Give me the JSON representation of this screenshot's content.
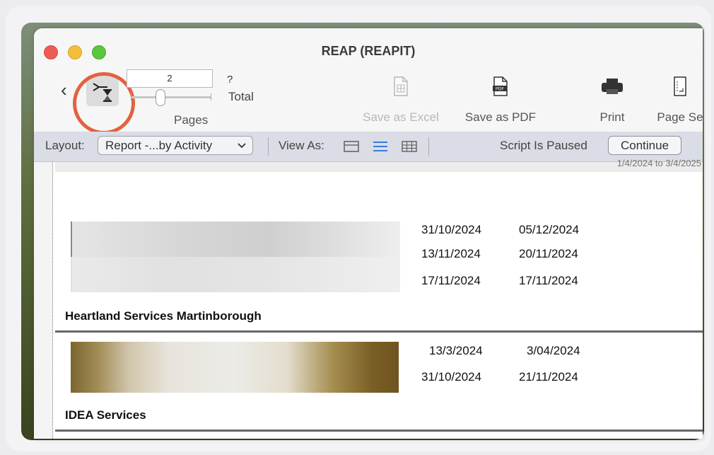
{
  "window": {
    "title": "REAP (REAPIT)"
  },
  "toolbar": {
    "back_icon": "chevron-left-icon",
    "script_icon": "script-hourglass-icon",
    "page_value": "2",
    "page_total_value": "?",
    "total_label": "Total",
    "pages_label": "Pages",
    "save_excel_label": "Save as Excel",
    "save_pdf_label": "Save as PDF",
    "print_label": "Print",
    "page_setup_label": "Page Se"
  },
  "layout_bar": {
    "layout_label": "Layout:",
    "layout_value": "Report -...by Activity",
    "view_as_label": "View As:",
    "status_text": "Script Is Paused",
    "continue_label": "Continue"
  },
  "report": {
    "header_fragment": "1/4/2024 to 3/4/2025",
    "groups": [
      {
        "provider": "Heartland Services Martinborough",
        "rows": [
          {
            "start": "31/10/2024",
            "end": "05/12/2024"
          },
          {
            "start": "13/11/2024",
            "end": "20/11/2024"
          },
          {
            "start": "17/11/2024",
            "end": "17/11/2024"
          }
        ]
      },
      {
        "provider": "IDEA Services",
        "rows": [
          {
            "start": "13/3/2024",
            "end": "3/04/2024"
          },
          {
            "start": "31/10/2024",
            "end": "21/11/2024"
          }
        ]
      }
    ]
  },
  "colors": {
    "highlight_ring": "#e2623f",
    "layout_bar_bg": "#dadde5",
    "view_list_selected": "#3d7bd9"
  }
}
